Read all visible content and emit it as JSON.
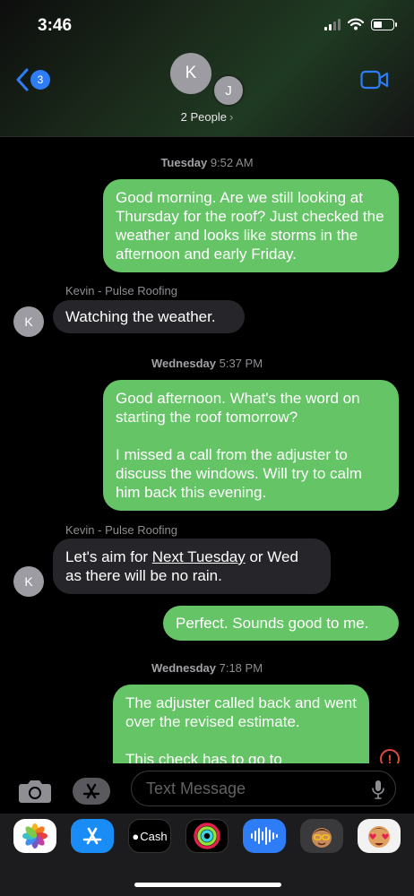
{
  "status": {
    "time": "3:46"
  },
  "header": {
    "back_count": "3",
    "avatars": [
      "K",
      "J"
    ],
    "people_label": "2 People",
    "chevron": "›"
  },
  "thread": {
    "timestamps": [
      {
        "day": "Tuesday",
        "time": "9:52 AM"
      },
      {
        "day": "Wednesday",
        "time": "5:37 PM"
      },
      {
        "day": "Wednesday",
        "time": "7:18 PM"
      }
    ],
    "sender_name": "Kevin - Pulse Roofing",
    "messages": [
      {
        "from": "me",
        "text": "Good morning. Are we still looking at Thursday for the roof? Just checked the weather and looks like storms in the afternoon and early Friday."
      },
      {
        "from": "Kevin",
        "avatar": "K",
        "text": "Watching the weather."
      },
      {
        "from": "me",
        "text": "Good afternoon. What's the word on starting the roof tomorrow?\n\nI missed a call from the adjuster to discuss the windows. Will try to calm him back this evening."
      },
      {
        "from": "Kevin",
        "avatar": "K",
        "text_before": "Let's aim for ",
        "link": "Next Tuesday",
        "text_after": " or Wed as there will be no rain."
      },
      {
        "from": "me",
        "text": "Perfect. Sounds good to me."
      },
      {
        "from": "me",
        "text": "The adjuster called back and went over the revised estimate.\n\nThis check has to go to"
      }
    ],
    "alert_glyph": "!"
  },
  "composer": {
    "placeholder": "Text Message"
  },
  "app_drawer": {
    "apps": [
      "photos-icon",
      "app-store-icon",
      "apple-cash-icon",
      "activity-icon",
      "audio-message-icon",
      "memoji-icon",
      "memoji-hearts-icon"
    ],
    "cash_label": "Cash"
  },
  "colors": {
    "outgoing": "#65c466",
    "incoming": "#26252a",
    "accent": "#2f7df6",
    "alert": "#e5483d"
  }
}
